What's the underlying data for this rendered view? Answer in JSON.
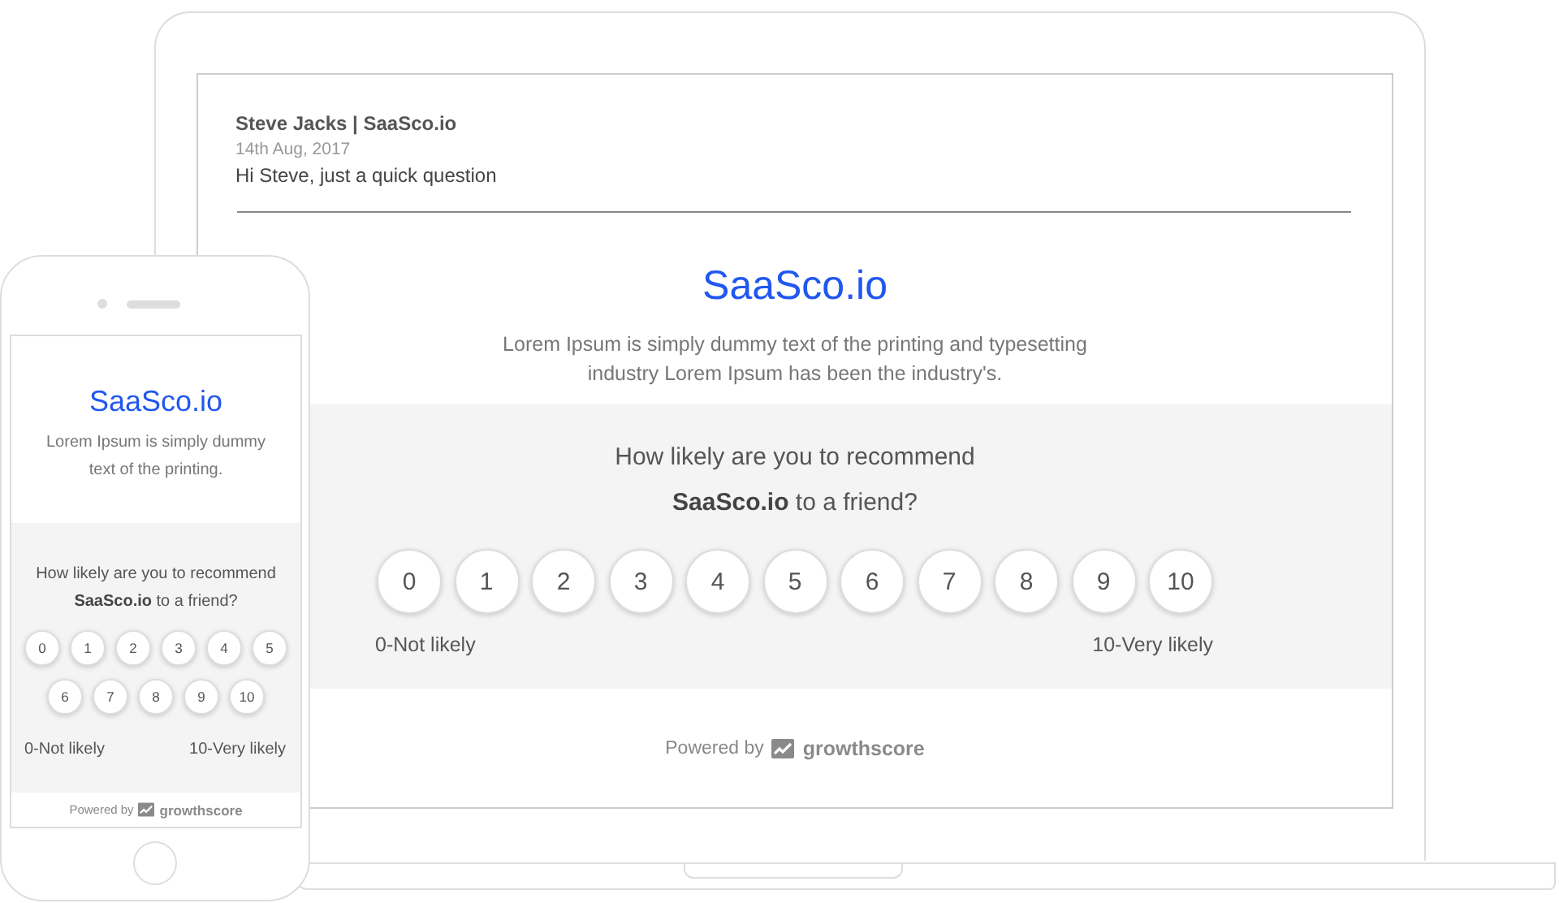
{
  "email": {
    "sender": "Steve Jacks | SaaSco.io",
    "date": "14th Aug, 2017",
    "subject": "Hi Steve, just a quick question"
  },
  "laptop_survey": {
    "brand": "SaaSco.io",
    "description": "Lorem Ipsum is simply dummy text of the printing and typesetting industry Lorem Ipsum has been the industry's.",
    "question": "How likely are you to recommend",
    "question_line2": "**SaaSco.io** to a friend?",
    "scores": [
      "0",
      "1",
      "2",
      "3",
      "4",
      "5",
      "6",
      "7",
      "8",
      "9",
      "10"
    ],
    "low_label": "0-Not likely",
    "high_label": "10-Very likely",
    "powered_by": "Powered by",
    "provider": "growthscore"
  },
  "phone_survey": {
    "brand": "SaaSco.io",
    "description": "Lorem Ipsum is simply dummy text of the printing.",
    "question": "How likely are you to recommend",
    "question_line2": "**SaaSco.io** to a friend?",
    "scores": [
      "0",
      "1",
      "2",
      "3",
      "4",
      "5",
      "6",
      "7",
      "8",
      "9",
      "10"
    ],
    "low_label": "0-Not likely",
    "high_label": "10-Very likely",
    "powered_by": "Powered by",
    "provider": "growthscore"
  }
}
